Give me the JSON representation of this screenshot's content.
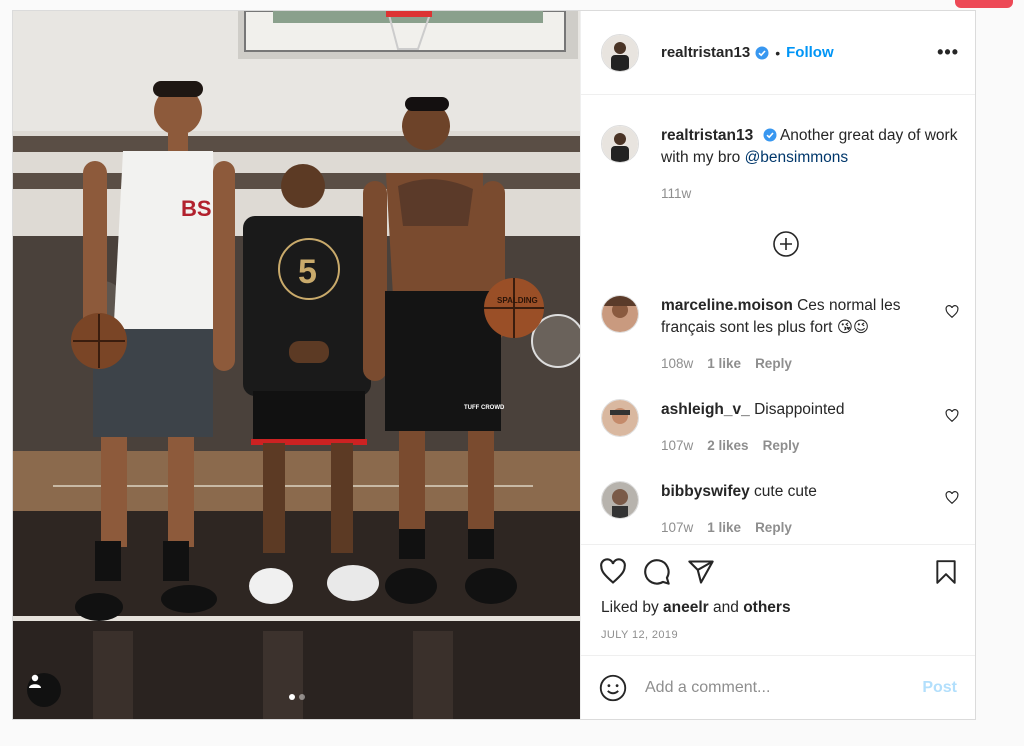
{
  "post": {
    "username": "realtristan13",
    "follow_label": "Follow",
    "more_label": "•••",
    "separator": "•"
  },
  "caption": {
    "username": "realtristan13",
    "text": "Another great day of work with my bro ",
    "mention": "@bensimmons",
    "age": "111w"
  },
  "comments": [
    {
      "username": "marceline.moison",
      "text": "Ces normal les français sont les plus fort 😘😉",
      "age": "108w",
      "likes": "1 like",
      "reply": "Reply"
    },
    {
      "username": "ashleigh_v_",
      "text": "Disappointed",
      "age": "107w",
      "likes": "2 likes",
      "reply": "Reply"
    },
    {
      "username": "bibbyswifey",
      "text": "cute cute",
      "age": "107w",
      "likes": "1 like",
      "reply": "Reply"
    }
  ],
  "likes": {
    "prefix": "Liked by ",
    "user": "aneelr",
    "middle": " and ",
    "others": "others"
  },
  "date": "JULY 12, 2019",
  "comment_box": {
    "placeholder": "Add a comment...",
    "post_label": "Post"
  },
  "photo": {
    "jersey_number": "5",
    "tank_logo": "BS",
    "shorts_text": "TUFF CROWD",
    "ball_text": "SPALDING"
  },
  "colors": {
    "accent": "#0095f6",
    "mention": "#00376b",
    "muted": "#8e8e8e",
    "post_disabled": "#b2dffc"
  },
  "icons": [
    "verified-badge-icon",
    "more-options-icon",
    "load-more-comments-icon",
    "heart-icon",
    "comment-icon",
    "share-icon",
    "bookmark-icon",
    "emoji-icon",
    "user-tag-icon"
  ]
}
